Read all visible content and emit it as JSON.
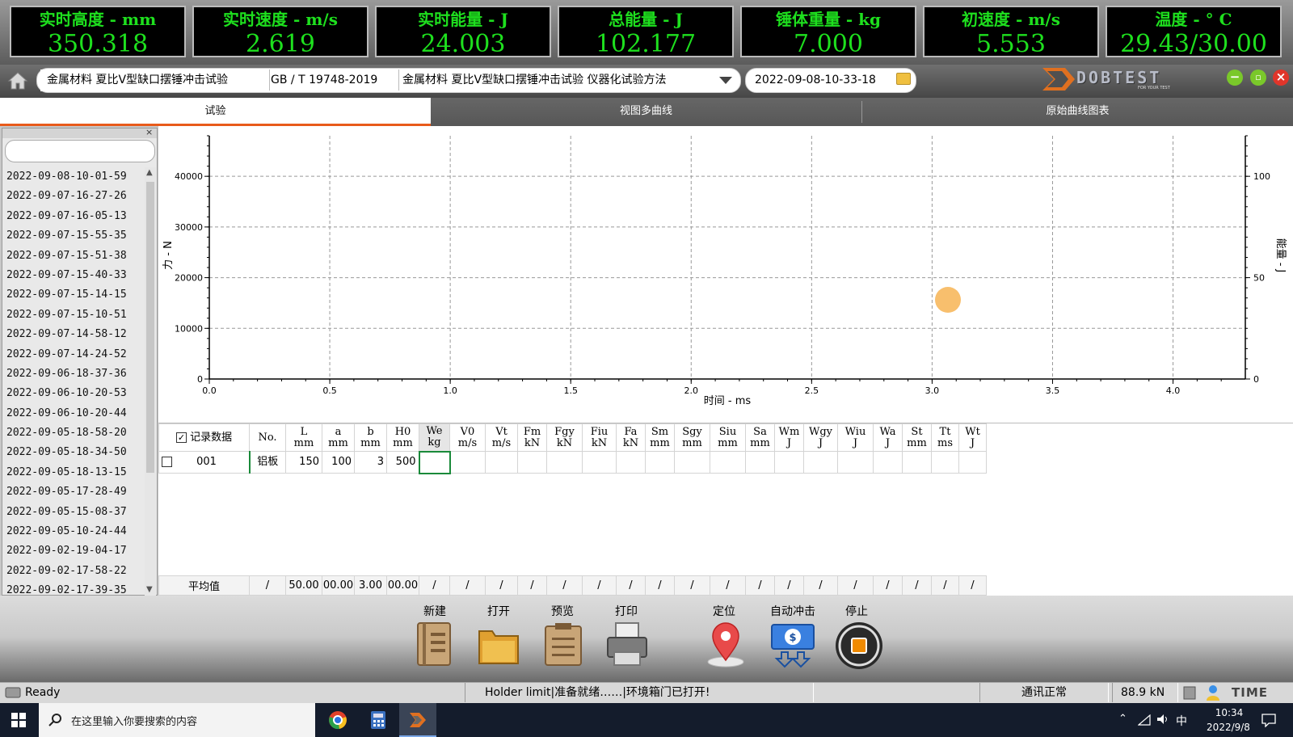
{
  "meters": [
    {
      "label": "实时高度 - mm",
      "value": "350.318"
    },
    {
      "label": "实时速度 - m/s",
      "value": "2.619"
    },
    {
      "label": "实时能量 - J",
      "value": "24.003"
    },
    {
      "label": "总能量 - J",
      "value": "102.177"
    },
    {
      "label": "锤体重量 - kg",
      "value": "7.000"
    },
    {
      "label": "初速度 - m/s",
      "value": "5.553"
    },
    {
      "label": "温度 - ° C",
      "value": "29.43/30.00"
    }
  ],
  "toolbar": {
    "material": "金属材料 夏比V型缺口摆锤冲击试验",
    "standard": "GB / T 19748-2019",
    "method": "金属材料 夏比V型缺口摆锤冲击试验 仪器化试验方法",
    "date": "2022-09-08-10-33-18",
    "brand": "DOBTEST",
    "brand_sub": "FOR YOUR TEST"
  },
  "tabs": [
    "试验",
    "视图多曲线",
    "原始曲线图表"
  ],
  "sidebar": {
    "search_value": "",
    "items": [
      "2022-09-08-10-01-59",
      "2022-09-07-16-27-26",
      "2022-09-07-16-05-13",
      "2022-09-07-15-55-35",
      "2022-09-07-15-51-38",
      "2022-09-07-15-40-33",
      "2022-09-07-15-14-15",
      "2022-09-07-15-10-51",
      "2022-09-07-14-58-12",
      "2022-09-07-14-24-52",
      "2022-09-06-18-37-36",
      "2022-09-06-10-20-53",
      "2022-09-06-10-20-44",
      "2022-09-05-18-58-20",
      "2022-09-05-18-34-50",
      "2022-09-05-18-13-15",
      "2022-09-05-17-28-49",
      "2022-09-05-15-08-37",
      "2022-09-05-10-24-44",
      "2022-09-02-19-04-17",
      "2022-09-02-17-58-22",
      "2022-09-02-17-39-35"
    ]
  },
  "chart_data": {
    "type": "line",
    "xlabel": "时间 - ms",
    "ylabel": "力 - N",
    "y2label": "能量 - J",
    "xlim": [
      0,
      4.3
    ],
    "ylim": [
      0,
      48000
    ],
    "y2lim": [
      0,
      120
    ],
    "xticks": [
      "0.0",
      "0.5",
      "1.0",
      "1.5",
      "2.0",
      "2.5",
      "3.0",
      "3.5",
      "4.0"
    ],
    "yticks": [
      "0",
      "10000",
      "20000",
      "30000",
      "40000"
    ],
    "y2ticks": [
      "0",
      "50",
      "100"
    ],
    "grid": true,
    "series": []
  },
  "table": {
    "record_label": "记录数据",
    "headers": [
      "No.",
      "L\nmm",
      "a\nmm",
      "b\nmm",
      "H0\nmm",
      "We\nkg",
      "V0\nm/s",
      "Vt\nm/s",
      "Fm\nkN",
      "Fgy\nkN",
      "Fiu\nkN",
      "Fa\nkN",
      "Sm\nmm",
      "Sgy\nmm",
      "Siu\nmm",
      "Sa\nmm",
      "Wm\nJ",
      "Wgy\nJ",
      "Wiu\nJ",
      "Wa\nJ",
      "St\nmm",
      "Tt\nms",
      "Wt\nJ"
    ],
    "rows": [
      {
        "id": "001",
        "cells": [
          "铝板",
          "150",
          "100",
          "3",
          "500",
          "",
          "",
          "",
          "",
          "",
          "",
          "",
          "",
          "",
          "",
          "",
          "",
          "",
          "",
          "",
          "",
          "",
          ""
        ]
      }
    ],
    "avg_label": "平均值",
    "avg_cells": [
      "/",
      "50.00",
      "00.00",
      "3.00",
      "00.00",
      "/",
      "/",
      "/",
      "/",
      "/",
      "/",
      "/",
      "/",
      "/",
      "/",
      "/",
      "/",
      "/",
      "/",
      "/",
      "/",
      "/",
      "/"
    ]
  },
  "buttons": {
    "new": "新建",
    "open": "打开",
    "preview": "预览",
    "print": "打印",
    "locate": "定位",
    "auto_impact": "自动冲击",
    "stop": "停止"
  },
  "status": {
    "ready": "Ready",
    "message": "Holder limit|准备就绪……|环境箱门已打开!",
    "comm": "通讯正常",
    "force": "88.9 kN",
    "brand": "TIME"
  },
  "taskbar": {
    "search_placeholder": "在这里输入你要搜索的内容",
    "ime": "中",
    "time": "10:34",
    "date": "2022/9/8"
  },
  "colors": {
    "meter_text": "#1ee01e",
    "tab_accent": "#e85a1a",
    "selected_cell": "#1a8a3a"
  }
}
